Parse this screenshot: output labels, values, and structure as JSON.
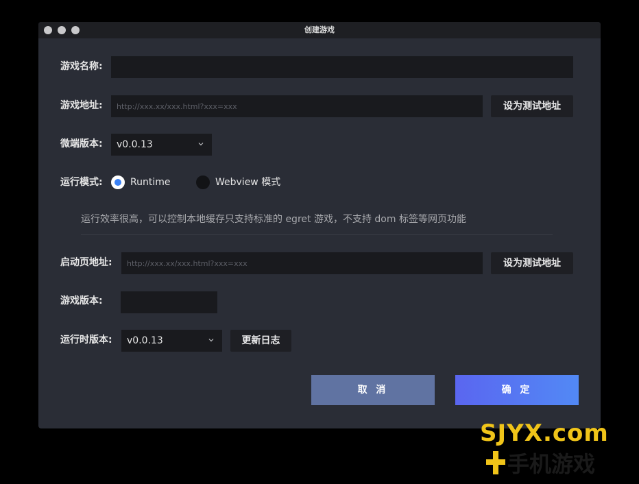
{
  "window": {
    "title": "创建游戏"
  },
  "form": {
    "game_name_label": "游戏名称:",
    "game_name_value": "",
    "game_url_label": "游戏地址:",
    "game_url_placeholder": "http://xxx.xx/xxx.html?xxx=xxx",
    "set_test_url_label": "设为测试地址",
    "micro_version_label": "微端版本:",
    "micro_version_value": "v0.0.13",
    "run_mode_label": "运行模式:",
    "run_mode_options": [
      {
        "label": "Runtime",
        "selected": true
      },
      {
        "label": "Webview 模式",
        "selected": false
      }
    ],
    "run_mode_hint": "运行效率很高，可以控制本地缓存只支持标准的 egret 游戏，不支持 dom 标签等网页功能",
    "start_page_label": "启动页地址:",
    "start_page_placeholder": "http://xxx.xx/xxx.html?xxx=xxx",
    "set_test_url_label_2": "设为测试地址",
    "game_version_label": "游戏版本:",
    "game_version_value": "",
    "runtime_version_label": "运行时版本:",
    "runtime_version_value": "v0.0.13",
    "changelog_label": "更新日志"
  },
  "actions": {
    "cancel_label": "取 消",
    "ok_label": "确 定"
  },
  "icons": {
    "dropdown": "chevron-down-icon"
  },
  "colors": {
    "window_bg": "#2a2d36",
    "input_bg": "#191a1e",
    "radio_accent": "#3b82f6",
    "cancel_bg": "#6073a2",
    "ok_gradient_start": "#5a66f0",
    "ok_gradient_end": "#5289f5"
  },
  "watermark": {
    "brand": "SJYX.com",
    "tagline": "手机游戏"
  }
}
